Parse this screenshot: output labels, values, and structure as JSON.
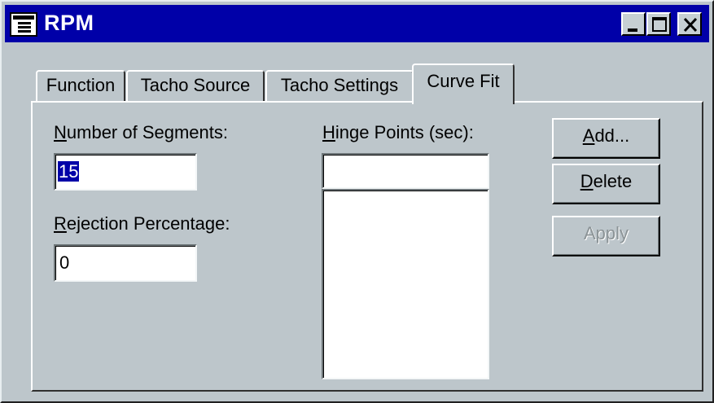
{
  "window": {
    "title": "RPM",
    "minimize_label": "_",
    "maximize_label": "□",
    "close_label": "×"
  },
  "tabs": [
    {
      "label": "Function",
      "active": false
    },
    {
      "label": "Tacho Source",
      "active": false
    },
    {
      "label": "Tacho Settings",
      "active": false
    },
    {
      "label": "Curve Fit",
      "active": true
    }
  ],
  "curve_fit": {
    "segments_label_mnemonic": "N",
    "segments_label_rest": "umber of Segments:",
    "segments_value": "15",
    "rejection_label_mnemonic": "R",
    "rejection_label_rest": "ejection Percentage:",
    "rejection_value": "0",
    "hinge_label_mnemonic": "H",
    "hinge_label_rest": "inge Points (sec):",
    "hinge_input_value": "",
    "hinge_list": []
  },
  "buttons": {
    "add_mnemonic": "A",
    "add_rest": "dd...",
    "delete_mnemonic": "D",
    "delete_rest": "elete",
    "apply_mnemonic": "A",
    "apply_rest": "pply",
    "apply_enabled": false
  },
  "colors": {
    "titlebar": "#0000a8",
    "face": "#bdc6cb",
    "selection": "#0000a8"
  }
}
